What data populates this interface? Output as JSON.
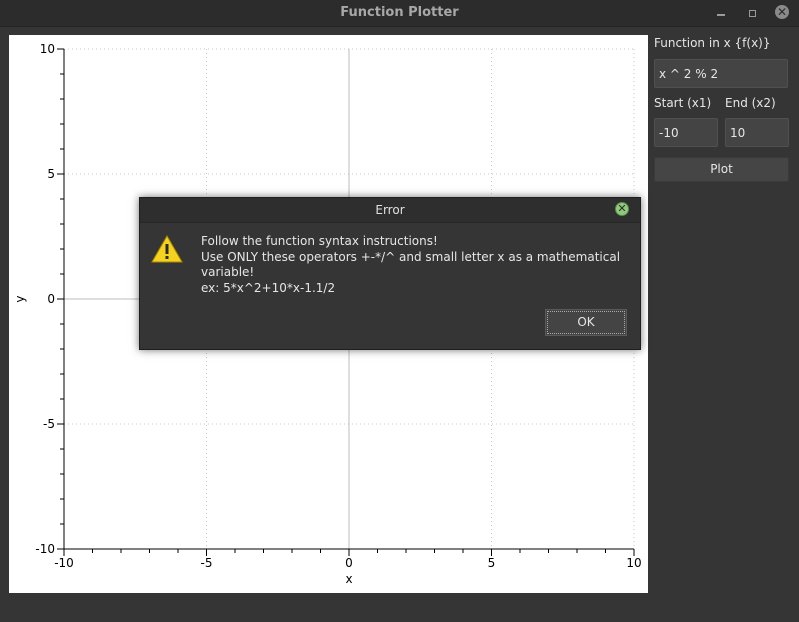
{
  "window": {
    "title": "Function Plotter",
    "close_glyph": "✕"
  },
  "panel": {
    "function_label": "Function in x {f(x)}",
    "function_value": "x ^ 2 % 2",
    "start_label": "Start (x1)",
    "end_label": "End (x2)",
    "start_value": "-10",
    "end_value": "10",
    "plot_button": "Plot"
  },
  "chart_data": {
    "type": "line",
    "xlabel": "x",
    "ylabel": "y",
    "xlim": [
      -10,
      10
    ],
    "ylim": [
      -10,
      10
    ],
    "x_ticks": [
      "-10",
      "-5",
      "0",
      "5",
      "10"
    ],
    "y_ticks": [
      "10",
      "5",
      "0",
      "-5",
      "-10"
    ],
    "grid": true,
    "series": []
  },
  "dialog": {
    "title": "Error",
    "close_glyph": "✕",
    "lines": [
      "Follow the function syntax instructions!",
      "Use ONLY these operators +-*/^ and small letter x as a mathematical variable!",
      "ex: 5*x^2+10*x-1.1/2"
    ],
    "ok_label": "OK"
  },
  "icons": {
    "warning": "warning-icon"
  },
  "colors": {
    "window_bg": "#353535",
    "warning_fill": "#f5d21f",
    "dialog_close": "#8fc97a"
  }
}
